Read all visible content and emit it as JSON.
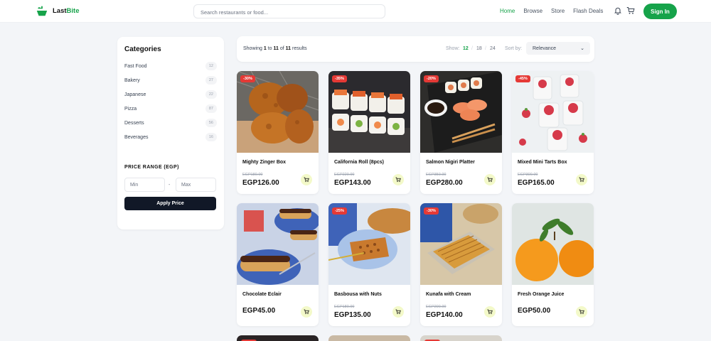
{
  "header": {
    "brand_first": "Last",
    "brand_second": "Bite",
    "search_placeholder": "Search restaurants or food...",
    "nav": [
      "Home",
      "Browse",
      "Store",
      "Flash Deals"
    ],
    "active_nav": "Home",
    "signin_label": "Sign In",
    "icons": [
      "logo-icon",
      "bell-icon",
      "cart-icon"
    ],
    "brand_color": "#16a34a"
  },
  "sidebar": {
    "title": "Categories",
    "categories": [
      {
        "label": "Fast Food",
        "count": "12"
      },
      {
        "label": "Bakery",
        "count": "27"
      },
      {
        "label": "Japanese",
        "count": "22"
      },
      {
        "label": "Pizza",
        "count": "87"
      },
      {
        "label": "Desserts",
        "count": "56"
      },
      {
        "label": "Beverages",
        "count": "16"
      }
    ],
    "price_title": "PRICE RANGE (EGP)",
    "min_placeholder": "Min",
    "max_placeholder": "Max",
    "apply_label": "Apply Price"
  },
  "toolbar": {
    "showing_prefix": "Showing",
    "range_start": "1",
    "to_word": "to",
    "range_end": "11",
    "of_word": "of",
    "total": "11",
    "results_word": "results",
    "show_label": "Show:",
    "show_options": [
      "12",
      "18",
      "24"
    ],
    "show_selected": "12",
    "sort_label": "Sort by:",
    "sort_value": "Relevance"
  },
  "products": [
    {
      "name": "Mighty Zinger Box",
      "discount": "-30%",
      "old_price": "EGP180.00",
      "price": "EGP126.00"
    },
    {
      "name": "California Roll (8pcs)",
      "discount": "-35%",
      "old_price": "EGP220.00",
      "price": "EGP143.00"
    },
    {
      "name": "Salmon Nigiri Platter",
      "discount": "-20%",
      "old_price": "EGP350.00",
      "price": "EGP280.00"
    },
    {
      "name": "Mixed Mini Tarts Box",
      "discount": "-45%",
      "old_price": "EGP300.00",
      "price": "EGP165.00"
    },
    {
      "name": "Chocolate Eclair",
      "discount": "",
      "old_price": "",
      "price": "EGP45.00"
    },
    {
      "name": "Basbousa with Nuts",
      "discount": "-25%",
      "old_price": "EGP180.00",
      "price": "EGP135.00"
    },
    {
      "name": "Kunafa with Cream",
      "discount": "-30%",
      "old_price": "EGP200.00",
      "price": "EGP140.00"
    },
    {
      "name": "Fresh Orange Juice",
      "discount": "",
      "old_price": "",
      "price": "EGP50.00"
    }
  ],
  "colors": {
    "discount_badge": "#e53935",
    "cart_button": "#f3f9c9",
    "apply_button": "#111827"
  }
}
